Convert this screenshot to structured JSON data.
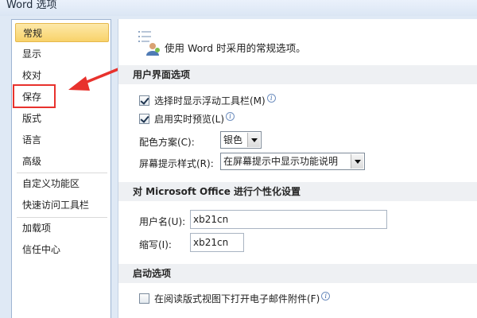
{
  "window": {
    "title": "Word 选项"
  },
  "sidebar": {
    "items": [
      {
        "label": "常规",
        "selected": true
      },
      {
        "label": "显示"
      },
      {
        "label": "校对"
      },
      {
        "label": "保存"
      },
      {
        "label": "版式"
      },
      {
        "label": "语言"
      },
      {
        "label": "高级"
      },
      {
        "label": "自定义功能区"
      },
      {
        "label": "快速访问工具栏"
      },
      {
        "label": "加载项"
      },
      {
        "label": "信任中心"
      }
    ]
  },
  "annotation": {
    "color": "#e8322d",
    "highlighted_item": "保存"
  },
  "main": {
    "header": "使用 Word 时采用的常规选项。",
    "sections": {
      "ui": {
        "title": "用户界面选项",
        "mini_toolbar": {
          "label": "选择时显示浮动工具栏(M)",
          "checked": true
        },
        "live_preview": {
          "label": "启用实时预览(L)",
          "checked": true
        },
        "color_scheme": {
          "label": "配色方案(C):",
          "value": "银色"
        },
        "screentip": {
          "label": "屏幕提示样式(R):",
          "value": "在屏幕提示中显示功能说明"
        }
      },
      "personalize": {
        "title": "对 Microsoft Office 进行个性化设置",
        "username": {
          "label": "用户名(U):",
          "value": "xb21cn"
        },
        "initials": {
          "label": "缩写(I):",
          "value": "xb21cn"
        }
      },
      "startup": {
        "title": "启动选项",
        "reading_layout": {
          "label": "在阅读版式视图下打开电子邮件附件(F)",
          "checked": false
        }
      }
    }
  },
  "colors": {
    "selected_item": "#f8d26a",
    "section_bg": "#eef0f3",
    "window_bg": "#dfe9f5"
  }
}
